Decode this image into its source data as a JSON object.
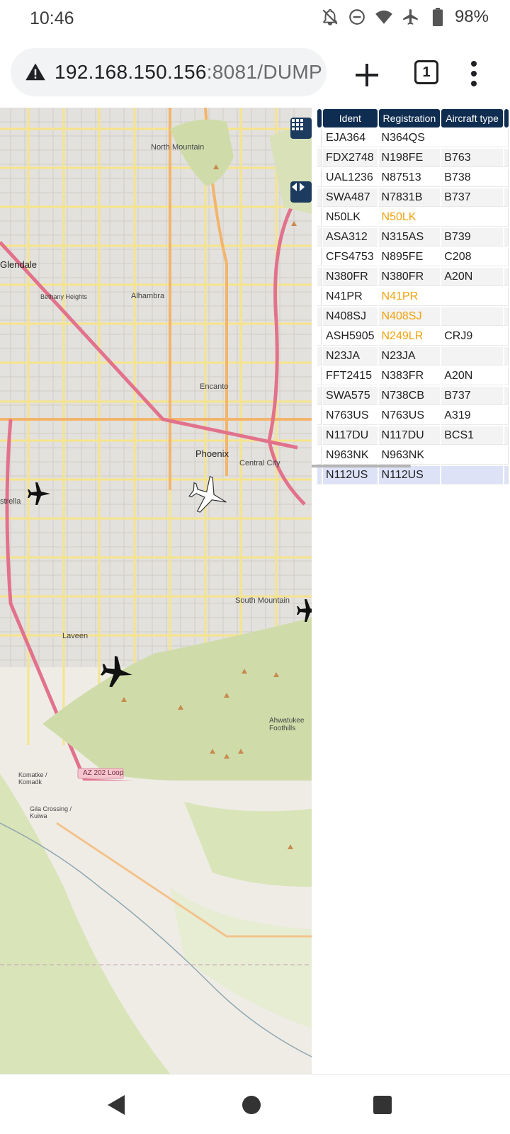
{
  "status_bar": {
    "time": "10:46",
    "battery": "98%",
    "icons": [
      "notifications-off-icon",
      "do-not-disturb-icon",
      "wifi-icon",
      "airplane-mode-icon",
      "battery-icon"
    ]
  },
  "browser": {
    "url_host": "192.168.150.156",
    "url_rest": ":8081/DUMP",
    "tab_count": "1"
  },
  "map": {
    "labels": {
      "north_mountain": "North Mountain",
      "glendale": "Glendale",
      "bethany_heights": "Bethany Heights",
      "alhambra": "Alhambra",
      "encanto": "Encanto",
      "phoenix": "Phoenix",
      "central_city": "Central City",
      "estrella": "strella",
      "south_mountain": "South Mountain",
      "laveen": "Laveen",
      "ahwatukee": "Ahwatukee Foothills",
      "komatke": "Komatke / Komadk",
      "gila_crossing": "Gila Crossing / Kuiwa",
      "az202": "AZ 202 Loop"
    }
  },
  "aircraft_table": {
    "columns": [
      "Ident",
      "Registration",
      "Aircraft type"
    ],
    "rows": [
      {
        "ident": "EJA364",
        "registration": "N364QS",
        "type": "",
        "reg_highlight": false
      },
      {
        "ident": "FDX2748",
        "registration": "N198FE",
        "type": "B763",
        "reg_highlight": false
      },
      {
        "ident": "UAL1236",
        "registration": "N87513",
        "type": "B738",
        "reg_highlight": false
      },
      {
        "ident": "SWA487",
        "registration": "N7831B",
        "type": "B737",
        "reg_highlight": false
      },
      {
        "ident": "N50LK",
        "registration": "N50LK",
        "type": "",
        "reg_highlight": true
      },
      {
        "ident": "ASA312",
        "registration": "N315AS",
        "type": "B739",
        "reg_highlight": false
      },
      {
        "ident": "CFS4753",
        "registration": "N895FE",
        "type": "C208",
        "reg_highlight": false
      },
      {
        "ident": "N380FR",
        "registration": "N380FR",
        "type": "A20N",
        "reg_highlight": false
      },
      {
        "ident": "N41PR",
        "registration": "N41PR",
        "type": "",
        "reg_highlight": true
      },
      {
        "ident": "N408SJ",
        "registration": "N408SJ",
        "type": "",
        "reg_highlight": true
      },
      {
        "ident": "ASH5905",
        "registration": "N249LR",
        "type": "CRJ9",
        "reg_highlight": true
      },
      {
        "ident": "N23JA",
        "registration": "N23JA",
        "type": "",
        "reg_highlight": false
      },
      {
        "ident": "FFT2415",
        "registration": "N383FR",
        "type": "A20N",
        "reg_highlight": false
      },
      {
        "ident": "SWA575",
        "registration": "N738CB",
        "type": "B737",
        "reg_highlight": false
      },
      {
        "ident": "N763US",
        "registration": "N763US",
        "type": "A319",
        "reg_highlight": false
      },
      {
        "ident": "N117DU",
        "registration": "N117DU",
        "type": "BCS1",
        "reg_highlight": false
      },
      {
        "ident": "N963NK",
        "registration": "N963NK",
        "type": "",
        "reg_highlight": false
      },
      {
        "ident": "N112US",
        "registration": "N112US",
        "type": "",
        "reg_highlight": false,
        "selected": true
      }
    ]
  },
  "colors": {
    "header_bg": "#0f2d50",
    "highlight_text": "#f2a20c",
    "selected_row": "#dde2f7"
  }
}
